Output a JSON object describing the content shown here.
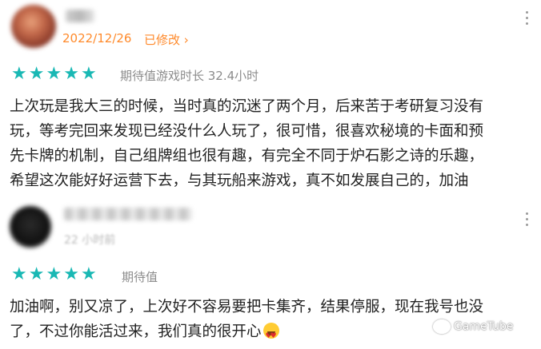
{
  "reviews": [
    {
      "date": "2022/12/26",
      "edited_label": "已修改 ›",
      "rating": 5,
      "meta": "期待值游戏时长 32.4小时",
      "lines": [
        "上次玩是我大三的时候，当时真的沉迷了两个月，后来苦于考研复习没有",
        "玩，等考完回来发现已经没什么人玩了，很可惜，很喜欢秘境的卡面和预",
        "先卡牌的机制，自己组牌组也很有趣，有完全不同于炉石影之诗的乐趣，",
        "希望这次能好好运营下去，与其玩船来游戏，真不如发展自己的，加油"
      ]
    },
    {
      "time": "22 小时前",
      "rating": 5,
      "meta": "期待值",
      "lines": [
        "加油啊，别又凉了，上次好不容易要把卡集齐，结果停服，现在我号也没",
        "了，不过你能活过来，我们真的很开心"
      ]
    }
  ],
  "watermark": "GameTube",
  "colors": {
    "accent": "#ff8a2b",
    "star": "#19b8b4",
    "meta": "#8c8c8c"
  },
  "icons": {
    "star": "star-icon",
    "menu": "more-vertical-icon",
    "emoji": "heart-eyes-emoji-icon"
  }
}
